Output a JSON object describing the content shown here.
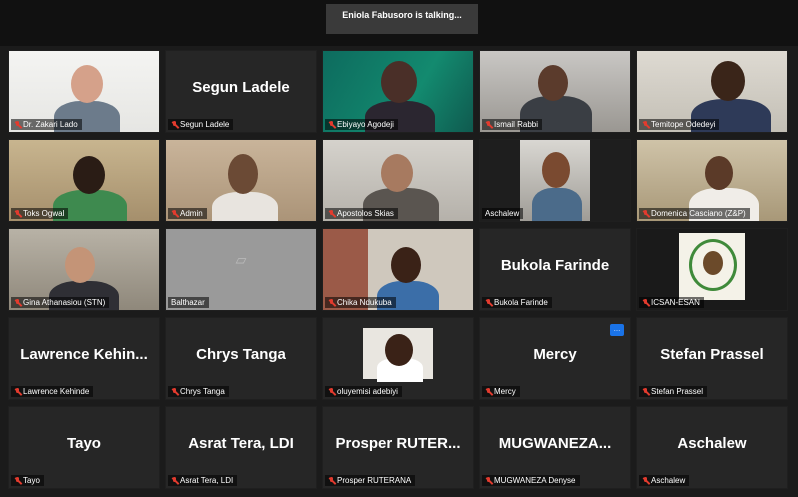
{
  "header": {
    "talking_text": "Eniola Fabusoro is talking..."
  },
  "tiles": [
    {
      "name": "Dr. Zakari Lado",
      "big": "",
      "video": true,
      "muted": true
    },
    {
      "name": "Segun Ladele",
      "big": "Segun Ladele",
      "video": false,
      "muted": true
    },
    {
      "name": "Ebiyayo Agodeji",
      "big": "",
      "video": true,
      "muted": true
    },
    {
      "name": "Ismail Rabbi",
      "big": "",
      "video": true,
      "muted": true
    },
    {
      "name": "Temitope Odedeyi",
      "big": "",
      "video": true,
      "muted": true
    },
    {
      "name": "Toks Ogwal",
      "big": "",
      "video": true,
      "muted": true
    },
    {
      "name": "Admin",
      "big": "",
      "video": true,
      "muted": true
    },
    {
      "name": "Apostolos Skias",
      "big": "",
      "video": true,
      "muted": true
    },
    {
      "name": "Aschalew",
      "big": "",
      "video": true,
      "muted": false
    },
    {
      "name": "Domenica Casciano (Z&P)",
      "big": "",
      "video": true,
      "muted": true
    },
    {
      "name": "Gina Athanasiou (STN)",
      "big": "",
      "video": true,
      "muted": true
    },
    {
      "name": "Balthazar",
      "big": "",
      "video": false,
      "muted": false
    },
    {
      "name": "Chika Ndukuba",
      "big": "",
      "video": true,
      "muted": true
    },
    {
      "name": "Bukola Farinde",
      "big": "Bukola Farinde",
      "video": false,
      "muted": true
    },
    {
      "name": "ICSAN-ESAN",
      "big": "",
      "video": true,
      "muted": true
    },
    {
      "name": "Lawrence Kehinde",
      "big": "Lawrence Kehin...",
      "video": false,
      "muted": true
    },
    {
      "name": "Chrys Tanga",
      "big": "Chrys Tanga",
      "video": false,
      "muted": true
    },
    {
      "name": "oluyemisi adebiyi",
      "big": "",
      "video": true,
      "muted": true
    },
    {
      "name": "Mercy",
      "big": "Mercy",
      "video": false,
      "muted": true
    },
    {
      "name": "Stefan Prassel",
      "big": "Stefan Prassel",
      "video": false,
      "muted": true
    },
    {
      "name": "Tayo",
      "big": "Tayo",
      "video": false,
      "muted": true
    },
    {
      "name": "Asrat Tera, LDI",
      "big": "Asrat Tera, LDI",
      "video": false,
      "muted": true
    },
    {
      "name": "Prosper RUTERANA",
      "big": "Prosper RUTER...",
      "video": false,
      "muted": true
    },
    {
      "name": "MUGWANEZA Denyse",
      "big": "MUGWANEZA...",
      "video": false,
      "muted": true
    },
    {
      "name": "Aschalew",
      "big": "Aschalew",
      "video": false,
      "muted": true
    }
  ],
  "colors": {
    "tile_bg": "#262626",
    "muted_mic": "#e23b2e",
    "page_bg": "#1b1b1b"
  }
}
